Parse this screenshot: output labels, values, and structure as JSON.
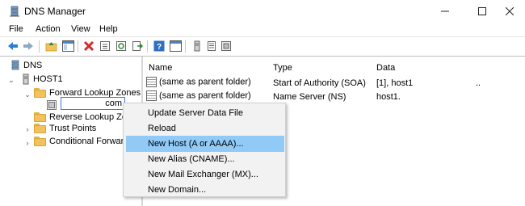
{
  "window": {
    "title": "DNS Manager"
  },
  "menubar": {
    "items": [
      "File",
      "Action",
      "View",
      "Help"
    ]
  },
  "toolbar": {
    "buttons": [
      "back-icon",
      "forward-icon",
      "up-folder-icon",
      "show-hide-tree-icon",
      "delete-icon",
      "properties-icon",
      "refresh-icon",
      "export-icon",
      "help-icon",
      "console-icon",
      "server-icon",
      "list-icon",
      "zone-icon"
    ]
  },
  "tree": {
    "root": "DNS",
    "server": "HOST1",
    "items": [
      "Forward Lookup Zones",
      "Reverse Lookup Zones",
      "Trust Points",
      "Conditional Forwarders"
    ],
    "rename_text": "com"
  },
  "list": {
    "columns": [
      "Name",
      "Type",
      "Data"
    ],
    "rows": [
      {
        "name": "(same as parent folder)",
        "type": "Start of Authority (SOA)",
        "data": "[1], host1",
        "extra": ".."
      },
      {
        "name": "(same as parent folder)",
        "type": "Name Server (NS)",
        "data": "host1.",
        "extra": ""
      }
    ]
  },
  "context_menu": {
    "items": [
      "Update Server Data File",
      "Reload",
      "New Host (A or AAAA)...",
      "New Alias (CNAME)...",
      "New Mail Exchanger (MX)...",
      "New Domain..."
    ],
    "highlighted_index": 2,
    "highlight_color": "#91c9f7"
  }
}
